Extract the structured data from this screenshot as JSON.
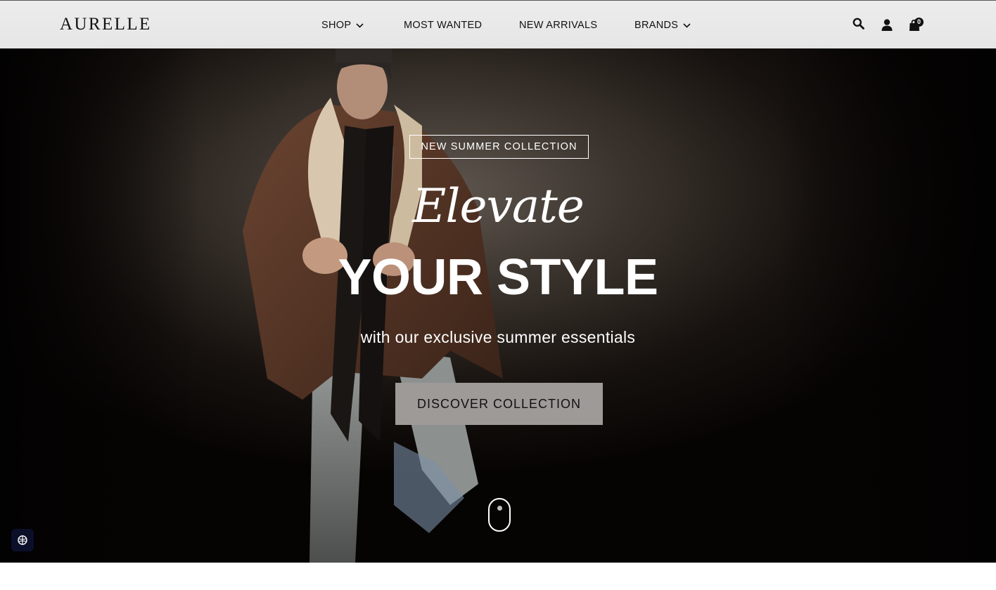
{
  "brand": {
    "logo": "AURELLE"
  },
  "nav": {
    "items": [
      {
        "label": "SHOP",
        "has_dropdown": true
      },
      {
        "label": "MOST WANTED",
        "has_dropdown": false
      },
      {
        "label": "NEW ARRIVALS",
        "has_dropdown": false
      },
      {
        "label": "BRANDS",
        "has_dropdown": true
      }
    ]
  },
  "header_icons": {
    "search": "search-icon",
    "account": "user-icon",
    "cart": "shopping-bag-icon",
    "cart_count": "0"
  },
  "hero": {
    "tag": "NEW SUMMER COLLECTION",
    "script_title": "Elevate",
    "title": "YOUR STYLE",
    "subtitle": "with our exclusive summer essentials",
    "cta_label": "DISCOVER COLLECTION",
    "scroll_indicator": "mouse-scroll-icon"
  },
  "accessibility_widget": {
    "icon": "accessibility-icon"
  },
  "colors": {
    "header_bg": "#e8e8e8",
    "hero_bg": "#070504",
    "cta_bg": "#9d9a97",
    "text_dark": "#111111",
    "text_light": "#ffffff",
    "widget_bg": "#0b0f2a"
  }
}
